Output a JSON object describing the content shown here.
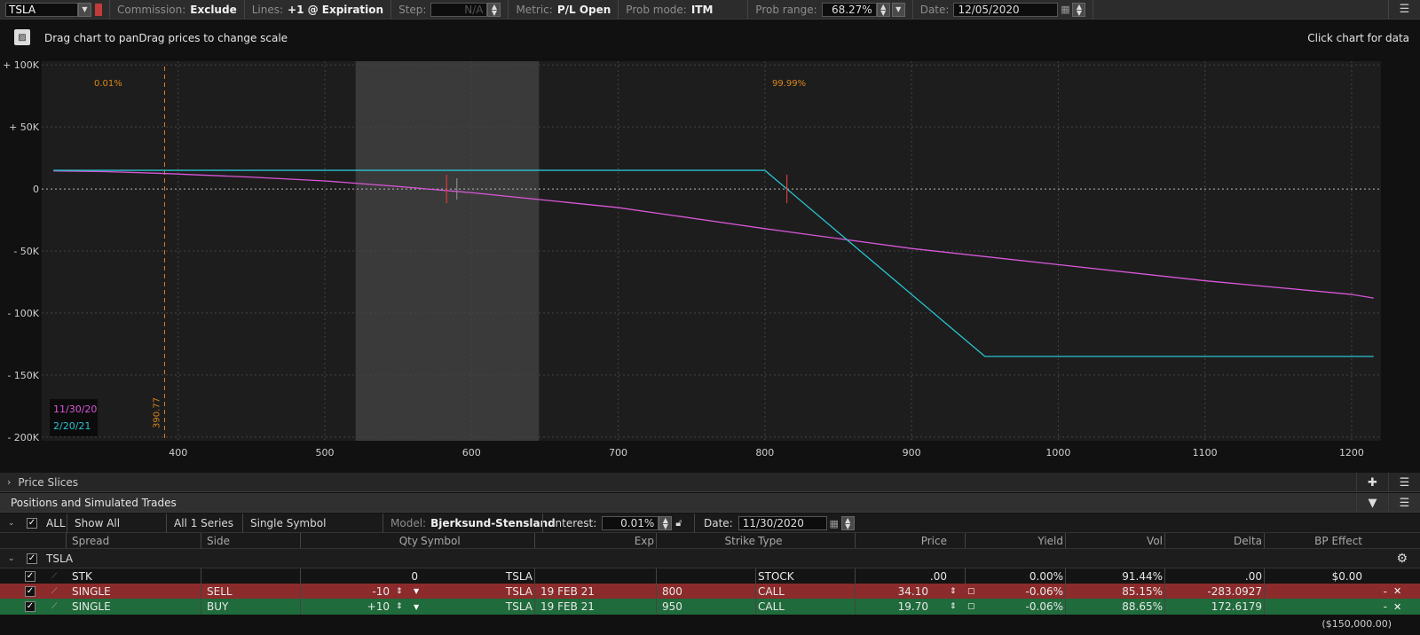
{
  "toolbar": {
    "symbol": "TSLA",
    "commission_label": "Commission:",
    "commission_value": "Exclude",
    "lines_label": "Lines:",
    "lines_value": "+1 @ Expiration",
    "step_label": "Step:",
    "step_value": "N/A",
    "metric_label": "Metric:",
    "metric_value": "P/L Open",
    "prob_mode_label": "Prob mode:",
    "prob_mode_value": "ITM",
    "prob_range_label": "Prob range:",
    "prob_range_value": "68.27%",
    "date_label": "Date:",
    "date_value": "12/05/2020"
  },
  "chart_header": {
    "hint": "Drag chart to panDrag prices to change scale",
    "click_hint": "Click chart for data"
  },
  "chart_data": {
    "type": "line",
    "x_ticks": [
      400,
      500,
      600,
      700,
      800,
      900,
      1000,
      1100,
      1200
    ],
    "y_ticks": [
      {
        "value": 100000,
        "label": "+ 100K"
      },
      {
        "value": 50000,
        "label": "+ 50K"
      },
      {
        "value": 0,
        "label": "0"
      },
      {
        "value": -50000,
        "label": "- 50K"
      },
      {
        "value": -100000,
        "label": "- 100K"
      },
      {
        "value": -150000,
        "label": "- 150K"
      },
      {
        "value": -200000,
        "label": "- 200K"
      }
    ],
    "xlim": [
      307,
      1220
    ],
    "ylim": [
      -203000,
      103000
    ],
    "prob_range_band": [
      521,
      646
    ],
    "current_price": 390.77,
    "current_price_label": "390.77",
    "prob_left_label": "0.01%",
    "prob_right_label": "99.99%",
    "series": [
      {
        "name": "11/30/20",
        "color": "#d957d9",
        "x": [
          315,
          350,
          390,
          450,
          500,
          550,
          580,
          600,
          650,
          700,
          800,
          850,
          900,
          1000,
          1100,
          1200,
          1215
        ],
        "y": [
          14500,
          14000,
          12500,
          9500,
          6500,
          2000,
          -1000,
          -3000,
          -9000,
          -15000,
          -32000,
          -40000,
          -48000,
          -61000,
          -74000,
          -85000,
          -88000
        ]
      },
      {
        "name": "2/20/21",
        "color": "#29c4d1",
        "x": [
          315,
          800,
          950,
          1215
        ],
        "y": [
          15000,
          15000,
          -135000,
          -135000
        ]
      }
    ]
  },
  "price_slices": {
    "label": "Price Slices"
  },
  "positions": {
    "title": "Positions and Simulated Trades",
    "filter_all": "ALL",
    "show_all": "Show All",
    "series": "All 1 Series",
    "single_symbol": "Single Symbol",
    "model_label": "Model:",
    "model_value": "Bjerksund-Stensland",
    "interest_label": "Interest:",
    "interest_value": "0.01%",
    "date_label": "Date:",
    "date_value": "11/30/2020",
    "columns": [
      "Spread",
      "Side",
      "Qty",
      "Symbol",
      "Exp",
      "Strike",
      "Type",
      "Price",
      "Yield",
      "Vol",
      "Delta",
      "BP Effect"
    ],
    "group": "TSLA",
    "rows": [
      {
        "spread": "STK",
        "side": "",
        "qty": "0",
        "symbol": "TSLA",
        "exp": "",
        "strike": "",
        "type": "STOCK",
        "price": ".00",
        "yield": "0.00%",
        "vol": "91.44%",
        "delta": ".00",
        "bp": "$0.00",
        "color": "#141414"
      },
      {
        "spread": "SINGLE",
        "side": "SELL",
        "qty": "-10",
        "symbol": "TSLA",
        "exp": "19 FEB 21",
        "strike": "800",
        "type": "CALL",
        "price": "34.10",
        "yield": "-0.06%",
        "vol": "85.15%",
        "delta": "-283.0927",
        "bp": "-",
        "color": "#8c2b2b"
      },
      {
        "spread": "SINGLE",
        "side": "BUY",
        "qty": "+10",
        "symbol": "TSLA",
        "exp": "19 FEB 21",
        "strike": "950",
        "type": "CALL",
        "price": "19.70",
        "yield": "-0.06%",
        "vol": "88.65%",
        "delta": "172.6179",
        "bp": "-",
        "color": "#1f6b3b"
      }
    ],
    "bp_total": "($150,000.00)"
  }
}
